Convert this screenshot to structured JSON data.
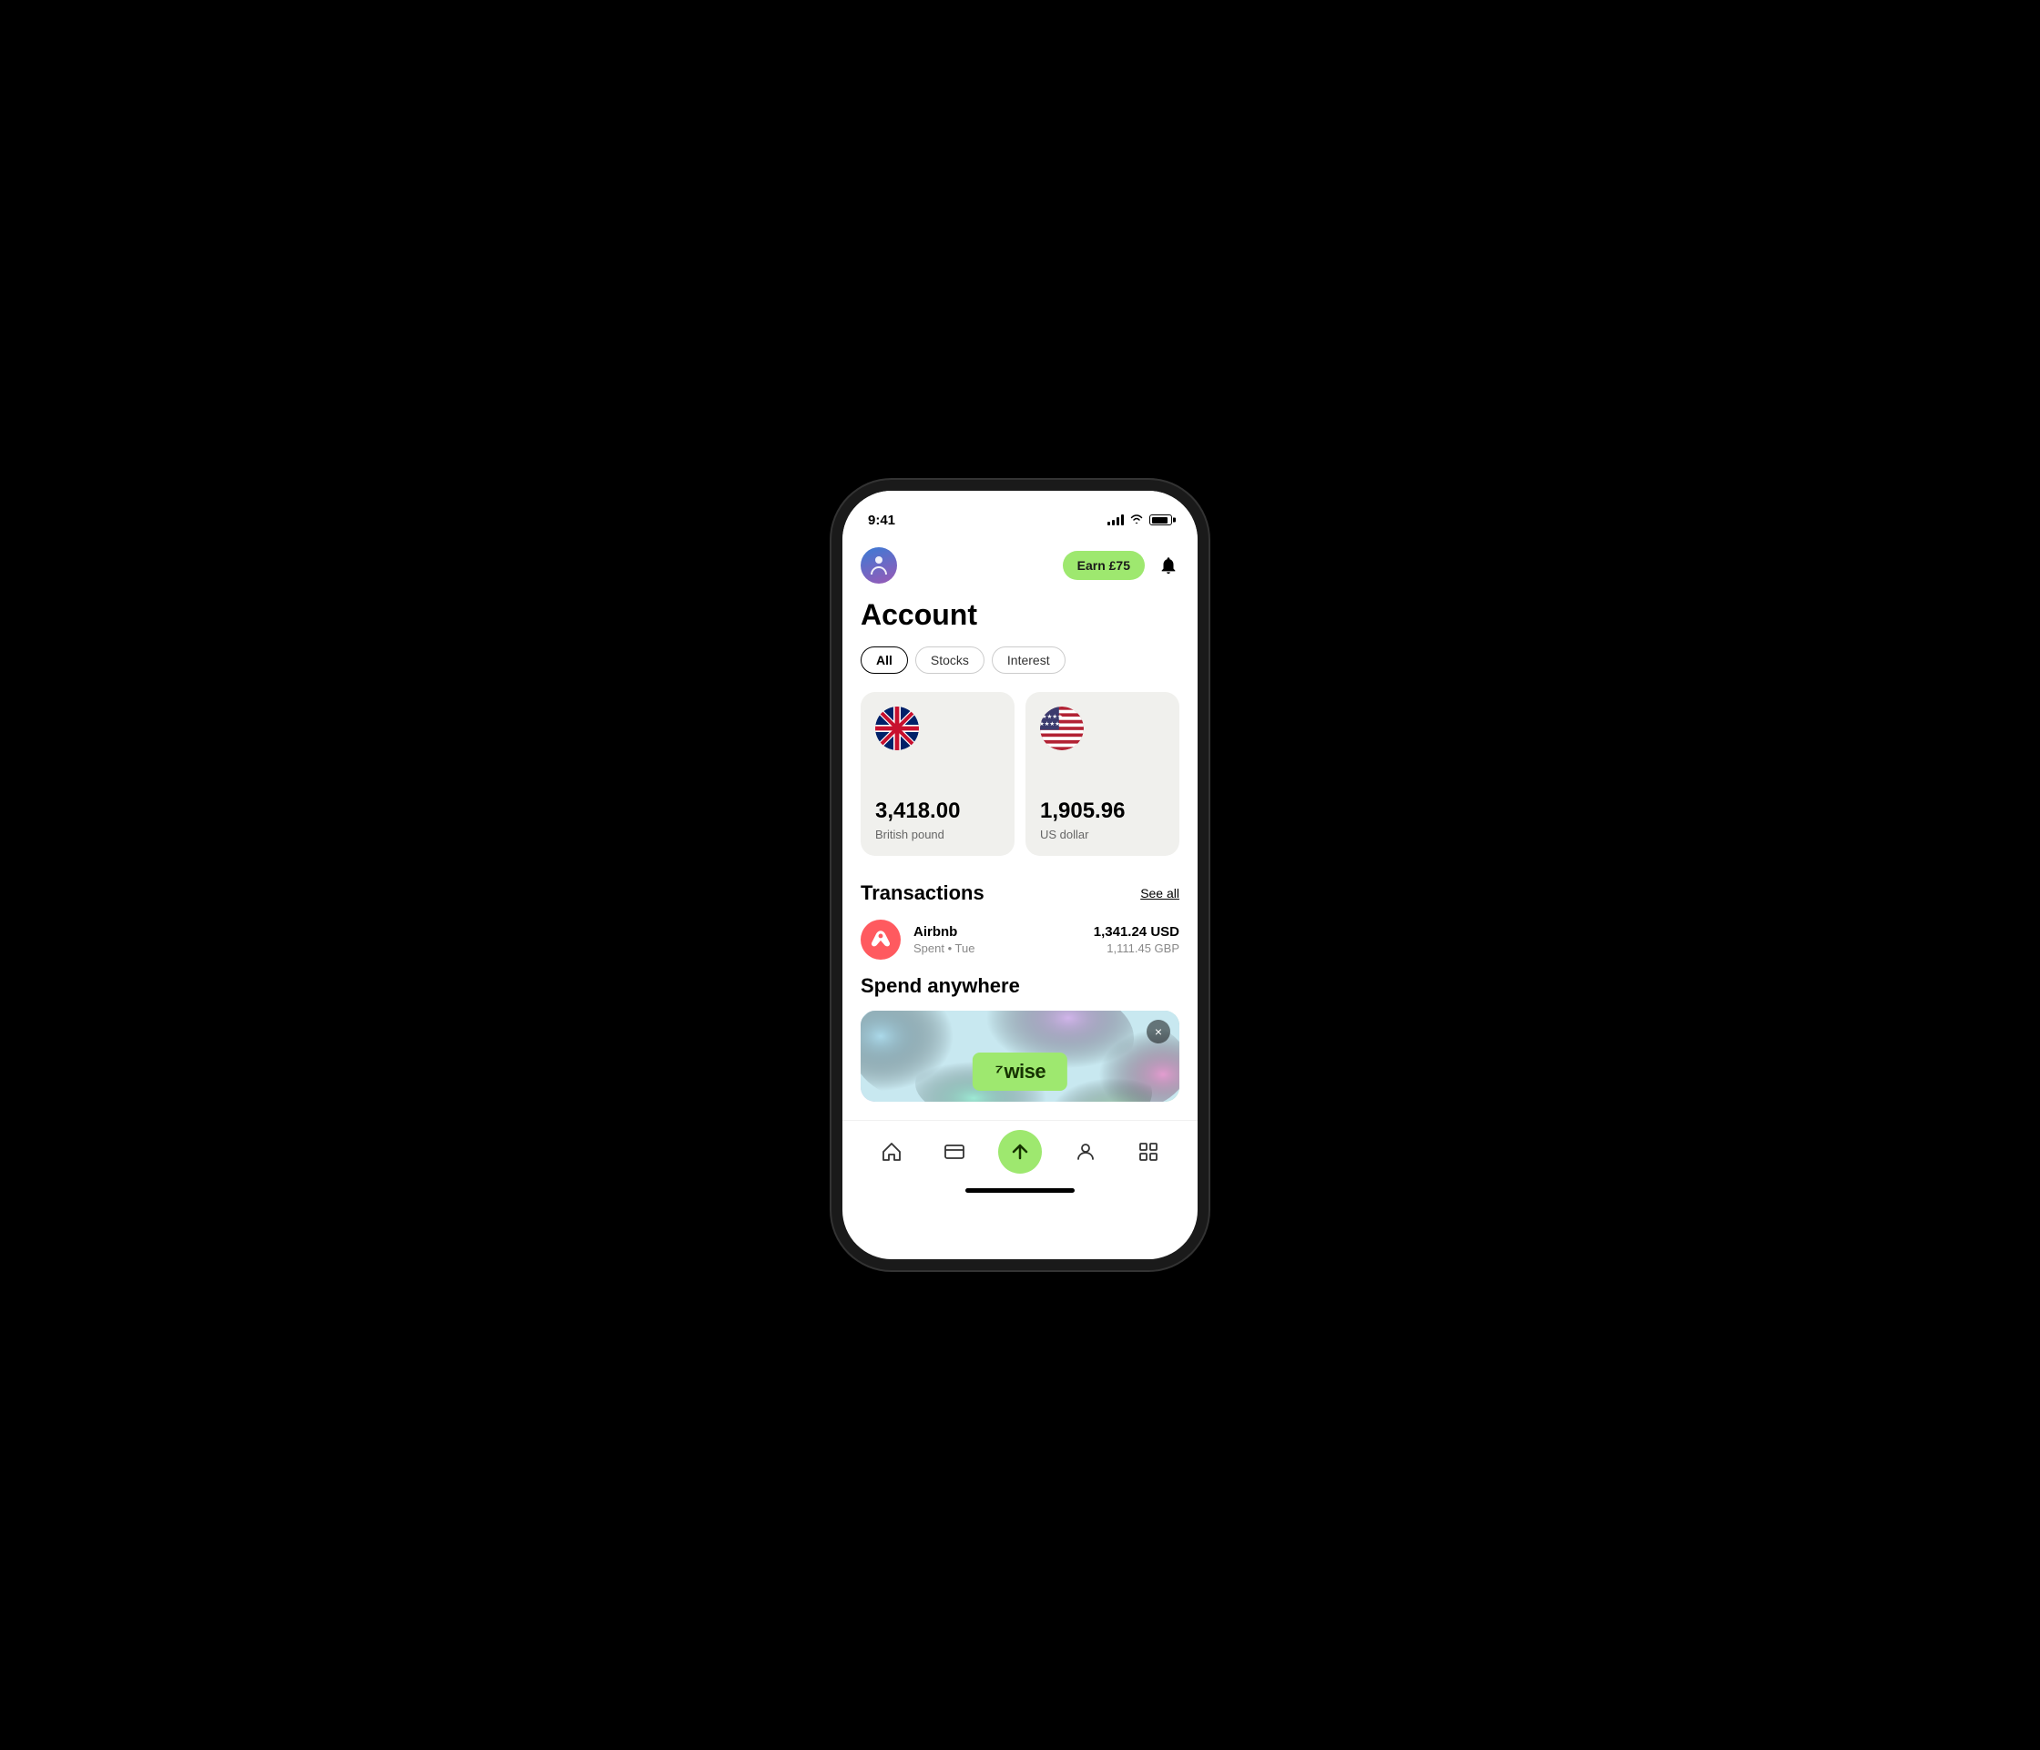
{
  "status_bar": {
    "time": "9:41"
  },
  "header": {
    "earn_button_label": "Earn £75"
  },
  "page": {
    "title": "Account"
  },
  "filter_tabs": [
    {
      "label": "All",
      "active": true
    },
    {
      "label": "Stocks",
      "active": false
    },
    {
      "label": "Interest",
      "active": false
    }
  ],
  "currency_cards": [
    {
      "amount": "3,418.00",
      "currency_name": "British pound",
      "flag": "uk"
    },
    {
      "amount": "1,905.96",
      "currency_name": "US dollar",
      "flag": "us"
    }
  ],
  "transactions": {
    "section_title": "Transactions",
    "see_all_label": "See all",
    "items": [
      {
        "name": "Airbnb",
        "sub": "Spent • Tue",
        "primary_amount": "1,341.24 USD",
        "secondary_amount": "1,111.45 GBP"
      }
    ]
  },
  "spend_section": {
    "title": "Spend anywhere",
    "card_logo": "⁷wise",
    "close_label": "×"
  },
  "bottom_nav": {
    "items": [
      {
        "name": "home",
        "icon": "home"
      },
      {
        "name": "card",
        "icon": "card"
      },
      {
        "name": "send",
        "icon": "send",
        "center": true
      },
      {
        "name": "profile",
        "icon": "profile"
      },
      {
        "name": "grid",
        "icon": "grid"
      }
    ]
  }
}
